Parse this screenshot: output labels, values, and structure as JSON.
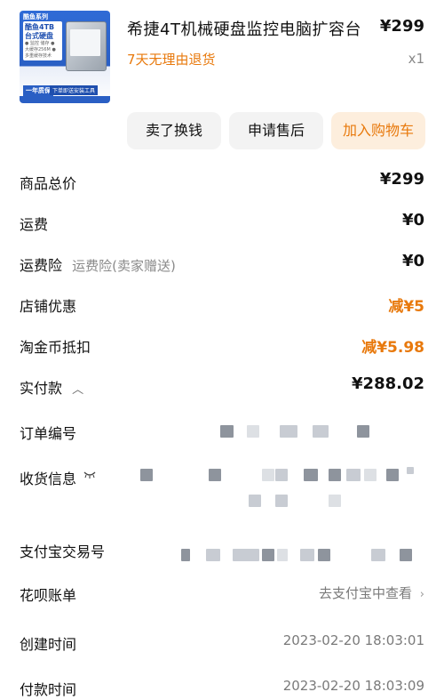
{
  "product": {
    "title": "希捷4T机械硬盘监控电脑扩容台",
    "price": "¥299",
    "return_policy": "7天无理由退货",
    "quantity": "x1",
    "thumbnail": {
      "series": "酷鱼系列",
      "line1": "酷鱼4TB",
      "line2": "台式硬盘",
      "specs": "● 监控 储存  ● 大缓存256M  ● 多重缓存技术",
      "warranty": "一年质保",
      "install_tool": "下单即送安装工具"
    }
  },
  "actions": {
    "sell": "卖了换钱",
    "after_sales": "申请售后",
    "add_cart": "加入购物车"
  },
  "summary": {
    "total_label": "商品总价",
    "total_value": "¥299",
    "shipping_label": "运费",
    "shipping_value": "¥0",
    "insurance_label": "运费险",
    "insurance_note": "运费险(卖家赠送)",
    "insurance_value": "¥0",
    "store_discount_label": "店铺优惠",
    "store_discount_value": "减¥5",
    "coin_label": "淘金币抵扣",
    "coin_value": "减¥5.98",
    "paid_label": "实付款",
    "paid_value": "¥288.02"
  },
  "info": {
    "order_no_label": "订单编号",
    "receiver_label": "收货信息",
    "alipay_label": "支付宝交易号",
    "huabei_label": "花呗账单",
    "huabei_link": "去支付宝中查看",
    "created_label": "创建时间",
    "created_value": "2023-02-20 18:03:01",
    "paid_time_label": "付款时间",
    "paid_time_value": "2023-02-20 18:03:09"
  },
  "colors": {
    "accent": "#e8790c",
    "button_bg": "#f3f3f3",
    "cart_bg": "#fdeedd"
  }
}
